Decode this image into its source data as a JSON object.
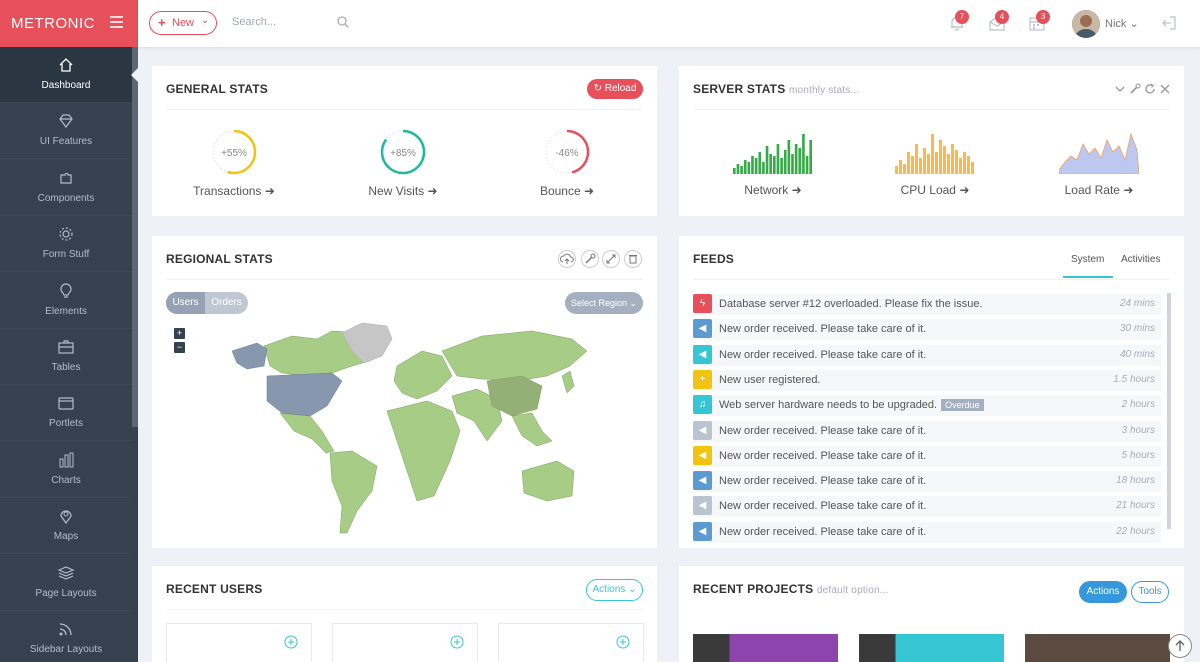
{
  "brand": {
    "logo": "METRONIC"
  },
  "header": {
    "new_label": "New",
    "search_placeholder": "Search...",
    "notif_count": "7",
    "inbox_count": "4",
    "tasks_count": "3",
    "user_name": "Nick"
  },
  "sidebar": {
    "items": [
      {
        "label": "Dashboard",
        "icon": "home-icon"
      },
      {
        "label": "UI Features",
        "icon": "diamond-icon"
      },
      {
        "label": "Components",
        "icon": "puzzle-icon"
      },
      {
        "label": "Form Stuff",
        "icon": "gear-icon"
      },
      {
        "label": "Elements",
        "icon": "bulb-icon"
      },
      {
        "label": "Tables",
        "icon": "briefcase-icon"
      },
      {
        "label": "Portlets",
        "icon": "wallet-icon"
      },
      {
        "label": "Charts",
        "icon": "bar-chart-icon"
      },
      {
        "label": "Maps",
        "icon": "pin-icon"
      },
      {
        "label": "Page Layouts",
        "icon": "layers-icon"
      },
      {
        "label": "Sidebar Layouts",
        "icon": "feed-icon"
      }
    ]
  },
  "general_stats": {
    "title": "GENERAL STATS",
    "reload_label": "Reload",
    "items": [
      {
        "value": "+55%",
        "label": "Transactions",
        "percent": 55,
        "color": "#f1c40f"
      },
      {
        "value": "+85%",
        "label": "New Visits",
        "percent": 85,
        "color": "#1bbc9b"
      },
      {
        "value": "-46%",
        "label": "Bounce",
        "percent": 46,
        "color": "#e7505a"
      }
    ]
  },
  "server_stats": {
    "title": "SERVER STATS",
    "subtitle": "monthly stats...",
    "items": [
      {
        "label": "Network",
        "color": "#35aa47"
      },
      {
        "label": "CPU Load",
        "color": "#ffb848"
      },
      {
        "label": "Load Rate",
        "color": "#bcc8f0"
      }
    ]
  },
  "regional_stats": {
    "title": "REGIONAL STATS",
    "toggle": [
      "Users",
      "Orders"
    ],
    "select_label": "Select Region"
  },
  "feeds": {
    "title": "FEEDS",
    "tabs": [
      "System",
      "Activities"
    ],
    "rows": [
      {
        "text": "Database server #12 overloaded. Please fix the issue.",
        "time": "24 mins",
        "color": "#e7505a",
        "icon": "bolt-icon",
        "tag": ""
      },
      {
        "text": "New order received. Please take care of it.",
        "time": "30 mins",
        "color": "#5c9bd1",
        "icon": "megaphone-icon",
        "tag": ""
      },
      {
        "text": "New order received. Please take care of it.",
        "time": "40 mins",
        "color": "#36c6d3",
        "icon": "megaphone-icon",
        "tag": ""
      },
      {
        "text": "New user registered.",
        "time": "1.5 hours",
        "color": "#f1c40f",
        "icon": "plus-icon",
        "tag": ""
      },
      {
        "text": "Web server hardware needs to be upgraded.",
        "time": "2 hours",
        "color": "#36c6d3",
        "icon": "bell-icon",
        "tag": "Overdue"
      },
      {
        "text": "New order received. Please take care of it.",
        "time": "3 hours",
        "color": "#bac3d0",
        "icon": "megaphone-icon",
        "tag": ""
      },
      {
        "text": "New order received. Please take care of it.",
        "time": "5 hours",
        "color": "#f1c40f",
        "icon": "megaphone-icon",
        "tag": ""
      },
      {
        "text": "New order received. Please take care of it.",
        "time": "18 hours",
        "color": "#5c9bd1",
        "icon": "megaphone-icon",
        "tag": ""
      },
      {
        "text": "New order received. Please take care of it.",
        "time": "21 hours",
        "color": "#bac3d0",
        "icon": "megaphone-icon",
        "tag": ""
      },
      {
        "text": "New order received. Please take care of it.",
        "time": "22 hours",
        "color": "#5c9bd1",
        "icon": "megaphone-icon",
        "tag": ""
      }
    ]
  },
  "recent_users": {
    "title": "RECENT USERS",
    "actions_label": "Actions"
  },
  "recent_projects": {
    "title": "RECENT PROJECTS",
    "subtitle": "default option...",
    "actions_label": "Actions",
    "tools_label": "Tools"
  }
}
